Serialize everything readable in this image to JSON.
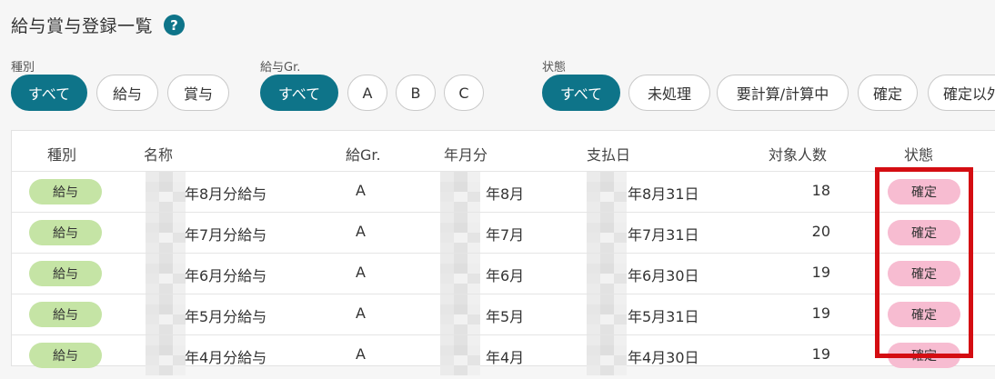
{
  "page": {
    "title": "給与賞与登録一覧",
    "help_glyph": "?"
  },
  "filters": {
    "type": {
      "label": "種別",
      "options": [
        "すべて",
        "給与",
        "賞与"
      ],
      "selected": "すべて"
    },
    "group": {
      "label": "給与Gr.",
      "options": [
        "すべて",
        "A",
        "B",
        "C"
      ],
      "selected": "すべて"
    },
    "status": {
      "label": "状態",
      "options": [
        "すべて",
        "未処理",
        "要計算/計算中",
        "確定",
        "確定以外"
      ],
      "selected": "すべて"
    }
  },
  "table": {
    "headers": {
      "type": "種別",
      "name": "名称",
      "group": "給Gr.",
      "period": "年月分",
      "paydate": "支払日",
      "count": "対象人数",
      "status": "状態"
    },
    "rows": [
      {
        "type": "給与",
        "name": "年8月分給与",
        "group": "A",
        "period": "年8月",
        "paydate": "年8月31日",
        "count": "18",
        "status": "確定"
      },
      {
        "type": "給与",
        "name": "年7月分給与",
        "group": "A",
        "period": "年7月",
        "paydate": "年7月31日",
        "count": "20",
        "status": "確定"
      },
      {
        "type": "給与",
        "name": "年6月分給与",
        "group": "A",
        "period": "年6月",
        "paydate": "年6月30日",
        "count": "19",
        "status": "確定"
      },
      {
        "type": "給与",
        "name": "年5月分給与",
        "group": "A",
        "period": "年5月",
        "paydate": "年5月31日",
        "count": "19",
        "status": "確定"
      },
      {
        "type": "給与",
        "name": "年4月分給与",
        "group": "A",
        "period": "年4月",
        "paydate": "年4月30日",
        "count": "19",
        "status": "確定"
      }
    ]
  },
  "colors": {
    "accent": "#0e7489",
    "type_badge": "#c5e4a5",
    "status_badge": "#f7bcd1",
    "highlight": "#d40d12"
  },
  "icons": {
    "help": "question-circle-icon"
  }
}
